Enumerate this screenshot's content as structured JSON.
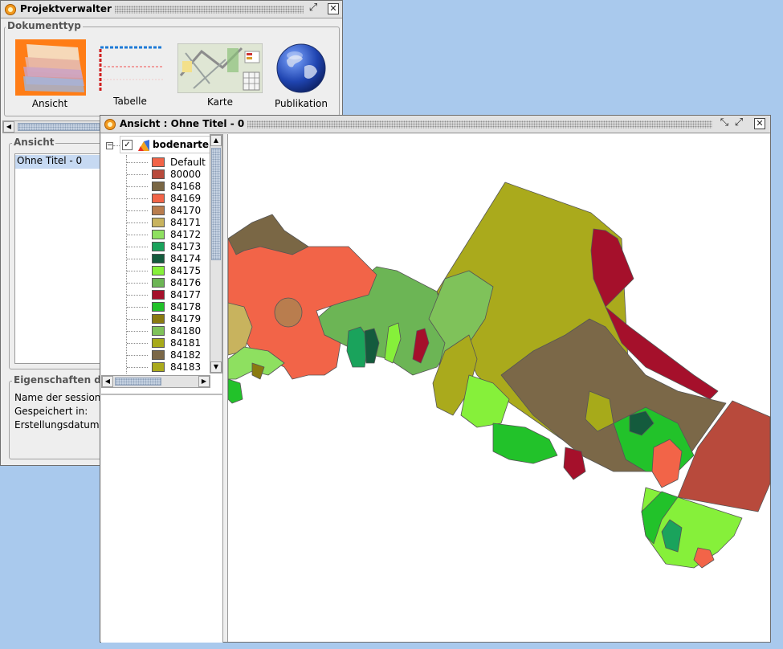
{
  "desktop": {
    "background": "#a9c9ed"
  },
  "project_manager": {
    "title": "Projektverwalter",
    "document_type_label": "Dokumenttyp",
    "doc_types": [
      {
        "label": "Ansicht",
        "icon": "view-icon"
      },
      {
        "label": "Tabelle",
        "icon": "table-icon"
      },
      {
        "label": "Karte",
        "icon": "map-layout-icon"
      },
      {
        "label": "Publikation",
        "icon": "globe-icon"
      }
    ],
    "views_group_label": "Ansicht",
    "views_list": [
      "Ohne Titel - 0"
    ],
    "properties_label": "Eigenschaften de",
    "properties": {
      "session_name_label": "Name der session",
      "saved_in_label": "Gespeichert in:",
      "created_label": "Erstellungsdatum:"
    }
  },
  "view_window": {
    "title": "Ansicht : Ohne Titel - 0",
    "layer": {
      "name": "bodenarten",
      "checked": true,
      "legend": [
        {
          "label": "Default",
          "color": "#f26448"
        },
        {
          "label": "80000",
          "color": "#b84a3c"
        },
        {
          "label": "84168",
          "color": "#7a6745"
        },
        {
          "label": "84169",
          "color": "#f26448"
        },
        {
          "label": "84170",
          "color": "#b97d4e"
        },
        {
          "label": "84171",
          "color": "#c8b35e"
        },
        {
          "label": "84172",
          "color": "#8ee060"
        },
        {
          "label": "84173",
          "color": "#1aa35c"
        },
        {
          "label": "84174",
          "color": "#145b3d"
        },
        {
          "label": "84175",
          "color": "#86f03a"
        },
        {
          "label": "84176",
          "color": "#6cb555"
        },
        {
          "label": "84177",
          "color": "#a5102b"
        },
        {
          "label": "84178",
          "color": "#22c22a"
        },
        {
          "label": "84179",
          "color": "#8a7a10"
        },
        {
          "label": "84180",
          "color": "#7fc25a"
        },
        {
          "label": "84181",
          "color": "#a7aa1a"
        },
        {
          "label": "84182",
          "color": "#7b6848"
        },
        {
          "label": "84183",
          "color": "#aaaa1c"
        }
      ]
    }
  }
}
